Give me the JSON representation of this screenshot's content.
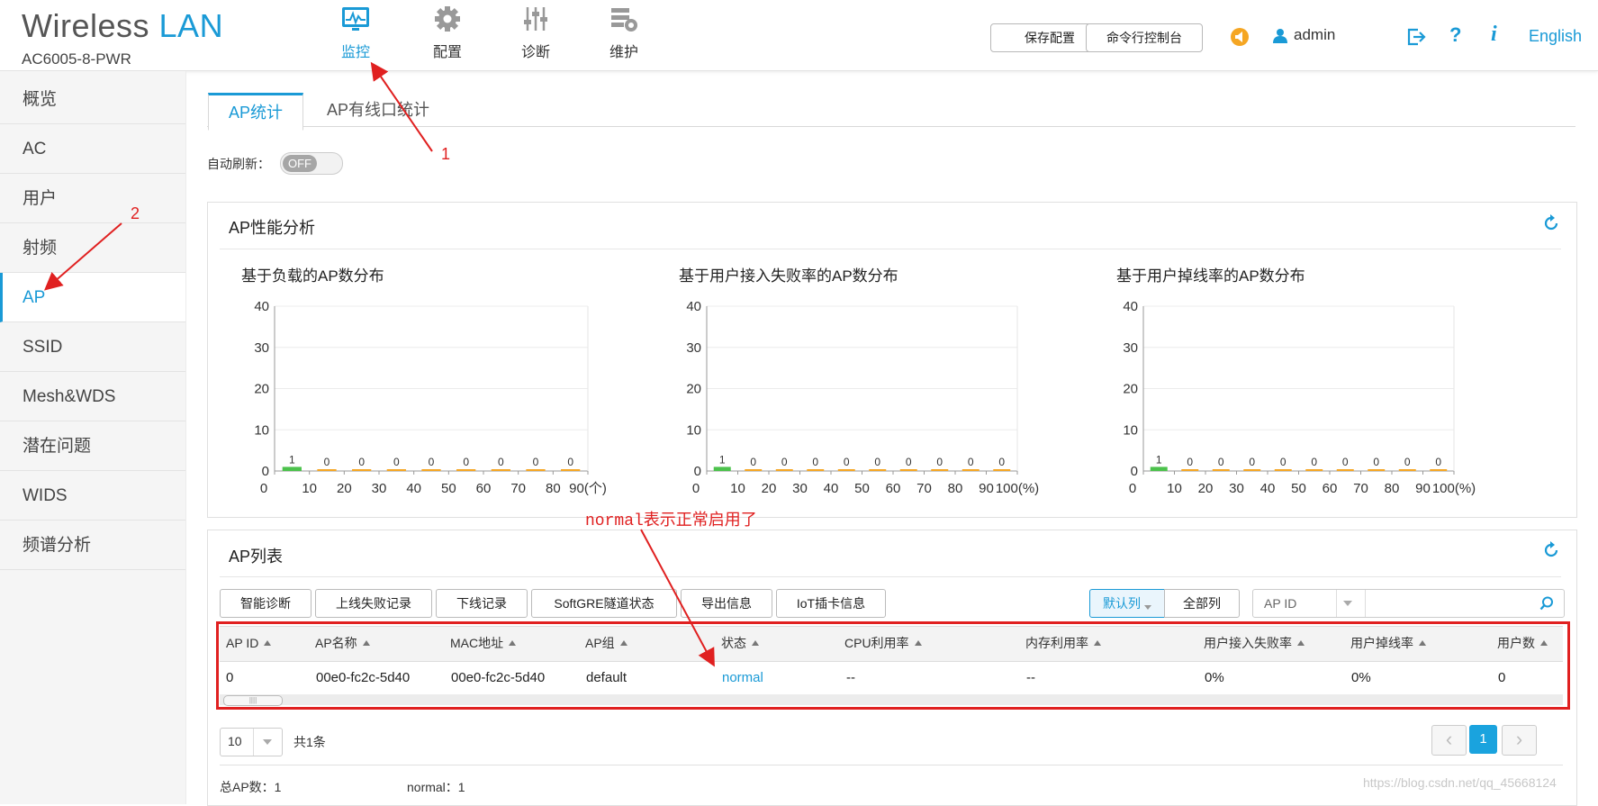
{
  "brand": {
    "title_part1": "Wireless",
    "title_part2": "LAN",
    "model": "AC6005-8-PWR"
  },
  "nav": [
    {
      "label": "监控",
      "icon": "monitor-icon",
      "active": true
    },
    {
      "label": "配置",
      "icon": "gear-icon",
      "active": false
    },
    {
      "label": "诊断",
      "icon": "sliders-icon",
      "active": false
    },
    {
      "label": "维护",
      "icon": "maintenance-icon",
      "active": false
    }
  ],
  "header_buttons": {
    "save": "保存配置",
    "cli": "命令行控制台"
  },
  "user": {
    "name": "admin"
  },
  "language": "English",
  "sidebar": [
    "概览",
    "AC",
    "用户",
    "射频",
    "AP",
    "SSID",
    "Mesh&WDS",
    "潜在问题",
    "WIDS",
    "频谱分析"
  ],
  "sidebar_active": "AP",
  "tabs": [
    "AP统计",
    "AP有线口统计"
  ],
  "auto_refresh": {
    "label": "自动刷新：",
    "state": "OFF"
  },
  "perf_panel": {
    "title": "AP性能分析"
  },
  "chart_data": [
    {
      "type": "bar",
      "title": "基于负载的AP数分布",
      "categories": [
        "0-10",
        "10-20",
        "20-30",
        "30-40",
        "40-50",
        "50-60",
        "60-70",
        "70-80",
        "80-90"
      ],
      "values": [
        1,
        0,
        0,
        0,
        0,
        0,
        0,
        0,
        0
      ],
      "x_ticks": [
        "0",
        "10",
        "20",
        "30",
        "40",
        "50",
        "60",
        "70",
        "80",
        "90(个)"
      ],
      "y_ticks": [
        "0",
        "10",
        "20",
        "30",
        "40"
      ],
      "ylim": [
        0,
        40
      ]
    },
    {
      "type": "bar",
      "title": "基于用户接入失败率的AP数分布",
      "categories": [
        "0-10",
        "10-20",
        "20-30",
        "30-40",
        "40-50",
        "50-60",
        "60-70",
        "70-80",
        "80-90",
        "90-100"
      ],
      "values": [
        1,
        0,
        0,
        0,
        0,
        0,
        0,
        0,
        0,
        0
      ],
      "x_ticks": [
        "0",
        "10",
        "20",
        "30",
        "40",
        "50",
        "60",
        "70",
        "80",
        "90",
        "100(%)"
      ],
      "y_ticks": [
        "0",
        "10",
        "20",
        "30",
        "40"
      ],
      "ylim": [
        0,
        40
      ]
    },
    {
      "type": "bar",
      "title": "基于用户掉线率的AP数分布",
      "categories": [
        "0-10",
        "10-20",
        "20-30",
        "30-40",
        "40-50",
        "50-60",
        "60-70",
        "70-80",
        "80-90",
        "90-100"
      ],
      "values": [
        1,
        0,
        0,
        0,
        0,
        0,
        0,
        0,
        0,
        0
      ],
      "x_ticks": [
        "0",
        "10",
        "20",
        "30",
        "40",
        "50",
        "60",
        "70",
        "80",
        "90",
        "100(%)"
      ],
      "y_ticks": [
        "0",
        "10",
        "20",
        "30",
        "40"
      ],
      "ylim": [
        0,
        40
      ]
    }
  ],
  "ap_list": {
    "title": "AP列表",
    "buttons": [
      "智能诊断",
      "上线失败记录",
      "下线记录",
      "SoftGRE隧道状态",
      "导出信息",
      "IoT插卡信息"
    ],
    "col_toggle": [
      "默认列",
      "全部列"
    ],
    "search_field": "AP ID",
    "columns": [
      "AP ID",
      "AP名称",
      "MAC地址",
      "AP组",
      "状态",
      "CPU利用率",
      "内存利用率",
      "用户接入失败率",
      "用户掉线率",
      "用户数"
    ],
    "rows": [
      [
        "0",
        "00e0-fc2c-5d40",
        "00e0-fc2c-5d40",
        "default",
        "normal",
        "--",
        "--",
        "0%",
        "0%",
        "0"
      ]
    ],
    "page_size": "10",
    "total": "共1条",
    "current_page": "1",
    "footer_total": "总AP数：1",
    "footer_normal": "normal：1"
  },
  "annotations": {
    "n1": "1",
    "n2": "2",
    "note": "normal表示正常启用了"
  },
  "watermark": "https://blog.csdn.net/qq_45668124",
  "colors": {
    "accent": "#1a9ad6",
    "annotation": "#e02020",
    "bar_green": "#4cc24c",
    "bar_orange": "#f5a623"
  }
}
